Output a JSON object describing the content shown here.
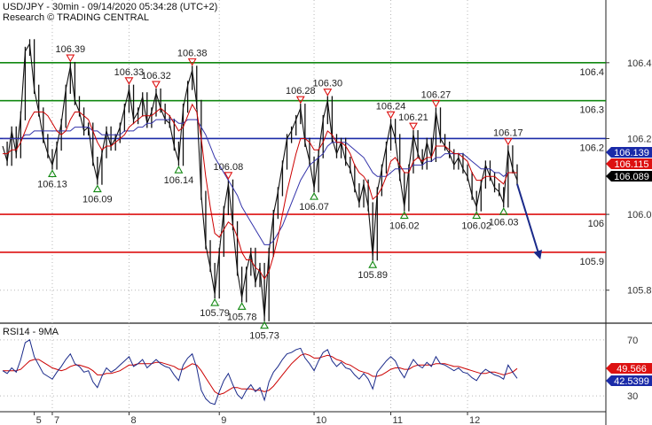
{
  "header": {
    "line1": "USD/JPY - 30min - 09/14/2020 05:34:28 (UTC+2)",
    "line2": "Research © TRADING CENTRAL"
  },
  "colors": {
    "price": "#111111",
    "ma_fast": "#cc0000",
    "ma_slow": "#3333aa",
    "resistance": "#118811",
    "pivot": "#1a2aa8",
    "support": "#dd1111",
    "forecast": "#1a2a8a",
    "rsi": "#1a2a8a",
    "rsi_ma": "#cc0000",
    "grid": "#b8b8b8"
  },
  "chart_data": [
    {
      "type": "line",
      "title": "USD/JPY - 30min - 09/14/2020 05:34:28 (UTC+2)",
      "x_ticks": [
        "5",
        "7",
        "8",
        "9",
        "10",
        "11",
        "12"
      ],
      "y_ticks": [
        106.4,
        106.2,
        106.0,
        105.8
      ],
      "ylim": [
        105.72,
        106.5
      ],
      "grid": true,
      "last_price_labels": [
        "106.139",
        "106.115",
        "106.089"
      ],
      "levels": [
        {
          "value": 106.4,
          "label": "106.4",
          "kind": "resistance"
        },
        {
          "value": 106.3,
          "label": "106.3",
          "kind": "resistance"
        },
        {
          "value": 106.2,
          "label": "106.2",
          "kind": "pivot"
        },
        {
          "value": 106.0,
          "label": "106",
          "kind": "support"
        },
        {
          "value": 105.9,
          "label": "105.9",
          "kind": "support"
        }
      ],
      "markers": [
        {
          "text": "106.39",
          "dir": "high",
          "i": 15
        },
        {
          "text": "106.33",
          "dir": "high",
          "i": 28
        },
        {
          "text": "106.32",
          "dir": "high",
          "i": 34
        },
        {
          "text": "106.38",
          "dir": "high",
          "i": 42
        },
        {
          "text": "106.08",
          "dir": "high",
          "i": 50
        },
        {
          "text": "106.28",
          "dir": "high",
          "i": 66
        },
        {
          "text": "106.30",
          "dir": "high",
          "i": 72
        },
        {
          "text": "106.24",
          "dir": "high",
          "i": 86
        },
        {
          "text": "106.21",
          "dir": "high",
          "i": 91
        },
        {
          "text": "106.27",
          "dir": "high",
          "i": 96
        },
        {
          "text": "106.17",
          "dir": "high",
          "i": 112
        },
        {
          "text": "106.13",
          "dir": "low",
          "i": 11
        },
        {
          "text": "106.09",
          "dir": "low",
          "i": 21
        },
        {
          "text": "106.14",
          "dir": "low",
          "i": 39
        },
        {
          "text": "105.79",
          "dir": "low",
          "i": 47
        },
        {
          "text": "105.78",
          "dir": "low",
          "i": 53
        },
        {
          "text": "105.73",
          "dir": "low",
          "i": 58
        },
        {
          "text": "106.07",
          "dir": "low",
          "i": 69
        },
        {
          "text": "105.89",
          "dir": "low",
          "i": 82
        },
        {
          "text": "106.02",
          "dir": "low",
          "i": 89
        },
        {
          "text": "106.02",
          "dir": "low",
          "i": 105
        },
        {
          "text": "106.03",
          "dir": "low",
          "i": 111
        }
      ],
      "forecast": {
        "from": 106.08,
        "to": 105.89
      },
      "series": [
        {
          "role": "price",
          "values": [
            106.18,
            106.14,
            106.22,
            106.16,
            106.26,
            106.43,
            106.45,
            106.33,
            106.27,
            106.2,
            106.16,
            106.13,
            106.18,
            106.24,
            106.33,
            106.39,
            106.3,
            106.27,
            106.22,
            106.23,
            106.14,
            106.09,
            106.16,
            106.22,
            106.18,
            106.2,
            106.23,
            106.28,
            106.33,
            106.25,
            106.27,
            106.31,
            106.24,
            106.27,
            106.32,
            106.28,
            106.25,
            106.24,
            106.18,
            106.14,
            106.28,
            106.34,
            106.38,
            106.29,
            106.05,
            105.92,
            105.86,
            105.79,
            105.9,
            106.01,
            106.08,
            105.97,
            105.85,
            105.78,
            105.85,
            105.9,
            105.82,
            105.86,
            105.73,
            105.9,
            106.0,
            106.06,
            106.13,
            106.2,
            106.22,
            106.25,
            106.28,
            106.19,
            106.14,
            106.07,
            106.16,
            106.25,
            106.3,
            106.2,
            106.16,
            106.19,
            106.14,
            106.12,
            106.07,
            106.03,
            106.08,
            106.02,
            105.89,
            106.06,
            106.12,
            106.18,
            106.24,
            106.2,
            106.1,
            106.02,
            106.12,
            106.21,
            106.16,
            106.13,
            106.19,
            106.15,
            106.27,
            106.2,
            106.18,
            106.16,
            106.13,
            106.15,
            106.12,
            106.1,
            106.05,
            106.02,
            106.08,
            106.13,
            106.1,
            106.07,
            106.06,
            106.03,
            106.17,
            106.12,
            106.09
          ]
        },
        {
          "role": "ma_fast",
          "values": [
            106.16,
            106.16,
            106.17,
            106.17,
            106.19,
            106.22,
            106.25,
            106.27,
            106.27,
            106.27,
            106.26,
            106.24,
            106.22,
            106.21,
            106.22,
            106.25,
            106.27,
            106.27,
            106.26,
            106.25,
            106.22,
            106.19,
            106.17,
            106.18,
            106.18,
            106.19,
            106.2,
            106.21,
            106.23,
            106.24,
            106.25,
            106.26,
            106.26,
            106.26,
            106.27,
            106.28,
            106.27,
            106.26,
            106.24,
            106.22,
            106.23,
            106.26,
            106.29,
            106.27,
            106.2,
            106.1,
            106.02,
            105.95,
            105.94,
            105.96,
            105.98,
            105.97,
            105.94,
            105.9,
            105.88,
            105.88,
            105.86,
            105.85,
            105.83,
            105.85,
            105.89,
            105.94,
            106.0,
            106.06,
            106.11,
            106.16,
            106.2,
            106.2,
            106.19,
            106.17,
            106.17,
            106.19,
            106.22,
            106.21,
            106.19,
            106.19,
            106.18,
            106.16,
            106.13,
            106.11,
            106.1,
            106.08,
            106.04,
            106.05,
            106.07,
            106.1,
            106.14,
            106.15,
            106.13,
            106.11,
            106.11,
            106.14,
            106.15,
            106.14,
            106.15,
            106.15,
            106.18,
            106.18,
            106.18,
            106.17,
            106.16,
            106.16,
            106.15,
            106.14,
            106.11,
            106.09,
            106.09,
            106.1,
            106.1,
            106.1,
            106.09,
            106.08,
            106.11,
            106.11,
            106.11
          ]
        },
        {
          "role": "ma_slow",
          "values": [
            106.2,
            106.2,
            106.2,
            106.2,
            106.2,
            106.21,
            106.21,
            106.22,
            106.22,
            106.22,
            106.22,
            106.22,
            106.22,
            106.22,
            106.22,
            106.22,
            106.23,
            106.23,
            106.23,
            106.23,
            106.22,
            106.22,
            106.21,
            106.21,
            106.21,
            106.21,
            106.21,
            106.22,
            106.22,
            106.22,
            106.23,
            106.23,
            106.24,
            106.24,
            106.25,
            106.25,
            106.25,
            106.25,
            106.25,
            106.24,
            106.24,
            106.25,
            106.25,
            106.25,
            106.23,
            106.21,
            106.18,
            106.15,
            106.13,
            106.11,
            106.09,
            106.07,
            106.05,
            106.02,
            106.0,
            105.98,
            105.96,
            105.94,
            105.92,
            105.92,
            105.93,
            105.95,
            105.97,
            106.0,
            106.03,
            106.06,
            106.09,
            106.11,
            106.13,
            106.14,
            106.15,
            106.16,
            106.18,
            106.19,
            106.19,
            106.19,
            106.19,
            106.18,
            106.17,
            106.16,
            106.15,
            106.13,
            106.11,
            106.1,
            106.1,
            106.1,
            106.11,
            106.12,
            106.12,
            106.12,
            106.12,
            106.13,
            106.13,
            106.13,
            106.14,
            106.14,
            106.15,
            106.15,
            106.16,
            106.16,
            106.16,
            106.16,
            106.16,
            106.15,
            106.14,
            106.13,
            106.12,
            106.12,
            106.12,
            106.11,
            106.11,
            106.1,
            106.11,
            106.11,
            106.11
          ]
        }
      ]
    },
    {
      "type": "line",
      "title": "RSI14 - 9MA",
      "y_ticks": [
        70,
        30
      ],
      "ylim": [
        20,
        80
      ],
      "current_labels": [
        "49.566",
        "42.5399"
      ],
      "series": [
        {
          "role": "rsi",
          "values": [
            48,
            46,
            50,
            47,
            56,
            68,
            70,
            58,
            52,
            46,
            44,
            42,
            47,
            51,
            56,
            60,
            53,
            51,
            47,
            48,
            40,
            36,
            44,
            50,
            47,
            49,
            52,
            55,
            58,
            51,
            53,
            56,
            50,
            53,
            56,
            53,
            51,
            50,
            45,
            41,
            52,
            57,
            60,
            50,
            34,
            28,
            25,
            24,
            33,
            41,
            46,
            38,
            31,
            28,
            34,
            38,
            33,
            36,
            27,
            40,
            47,
            51,
            56,
            60,
            61,
            63,
            64,
            57,
            53,
            48,
            55,
            61,
            63,
            55,
            51,
            54,
            50,
            49,
            45,
            42,
            46,
            42,
            35,
            47,
            51,
            55,
            58,
            55,
            48,
            43,
            50,
            56,
            52,
            50,
            54,
            51,
            58,
            53,
            52,
            50,
            48,
            50,
            47,
            46,
            43,
            41,
            46,
            49,
            47,
            45,
            44,
            42,
            52,
            47,
            42.54
          ]
        },
        {
          "role": "rsi_ma",
          "values": [
            48,
            48,
            48,
            48,
            49,
            52,
            55,
            56,
            56,
            54,
            52,
            50,
            49,
            48,
            49,
            51,
            52,
            52,
            51,
            50,
            48,
            45,
            45,
            46,
            46,
            47,
            48,
            50,
            52,
            52,
            53,
            53,
            53,
            53,
            54,
            54,
            53,
            52,
            51,
            49,
            49,
            51,
            53,
            52,
            48,
            43,
            38,
            33,
            31,
            32,
            34,
            36,
            36,
            35,
            35,
            35,
            34,
            34,
            33,
            34,
            37,
            41,
            45,
            49,
            53,
            56,
            59,
            60,
            59,
            57,
            57,
            58,
            59,
            58,
            56,
            55,
            53,
            52,
            50,
            48,
            47,
            46,
            44,
            44,
            45,
            47,
            49,
            50,
            50,
            49,
            49,
            51,
            52,
            52,
            52,
            52,
            53,
            53,
            53,
            52,
            51,
            51,
            50,
            49,
            48,
            47,
            46,
            46,
            47,
            47,
            46,
            45,
            46,
            47,
            49.57
          ]
        }
      ]
    }
  ]
}
